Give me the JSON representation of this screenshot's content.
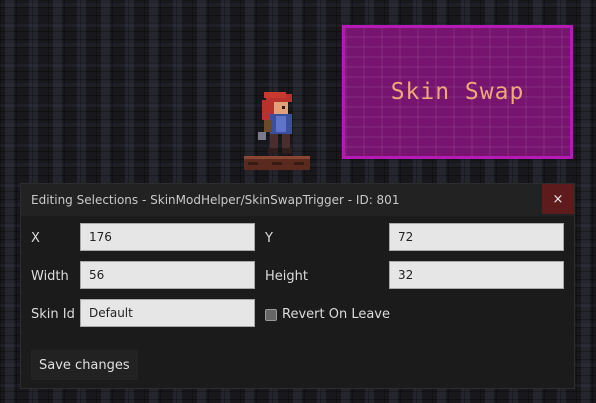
{
  "scene": {
    "trigger_label": "Skin Swap"
  },
  "dialog": {
    "title": "Editing Selections - SkinModHelper/SkinSwapTrigger - ID: 801",
    "close_icon": "×",
    "fields": {
      "x": {
        "label": "X",
        "value": "176"
      },
      "y": {
        "label": "Y",
        "value": "72"
      },
      "width": {
        "label": "Width",
        "value": "56"
      },
      "height": {
        "label": "Height",
        "value": "32"
      },
      "skin_id": {
        "label": "Skin Id",
        "value": "Default"
      }
    },
    "revert_on_leave": {
      "label": "Revert On Leave",
      "checked": false
    },
    "save_label": "Save changes"
  },
  "colors": {
    "trigger_fill": "#76146f",
    "trigger_border": "#b51ab5",
    "trigger_text": "#f0a878",
    "close_button": "#5e1b1b"
  }
}
